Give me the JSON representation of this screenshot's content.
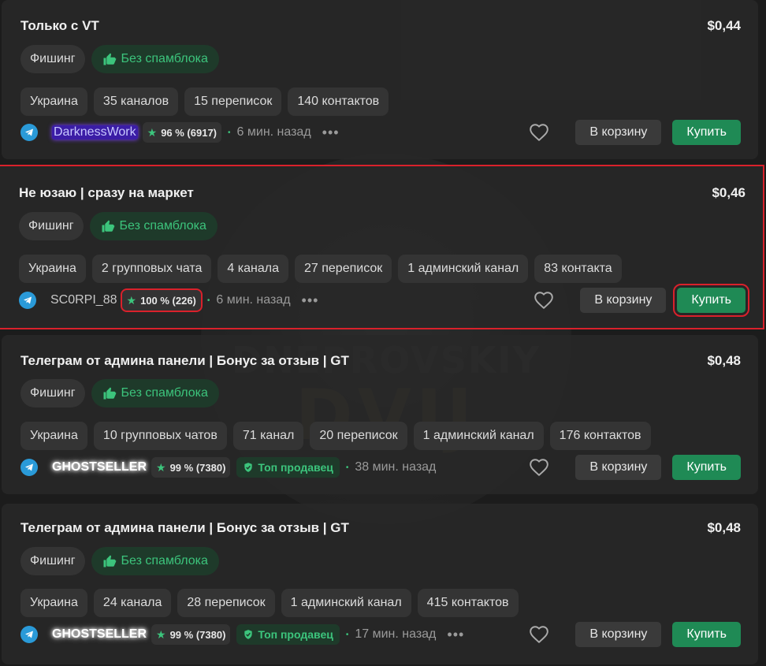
{
  "watermark": {
    "line1": "DNEPROVSKIY",
    "line2": "DVIJ"
  },
  "common": {
    "category": "Фишинг",
    "no_spamblock": "Без спамблока",
    "cart_label": "В корзину",
    "buy_label": "Купить",
    "more": "•••",
    "top_seller": "Топ продавец"
  },
  "listings": [
    {
      "title": "Только с VT",
      "price": "$0,44",
      "tags": [
        "Украина",
        "35 каналов",
        "15 переписок",
        "140 контактов"
      ],
      "seller": "DarknessWork",
      "rating": "96 % (6917)",
      "time": "6 мин. назад"
    },
    {
      "title": "Не юзаю | сразу на маркет",
      "price": "$0,46",
      "tags": [
        "Украина",
        "2 групповых чата",
        "4 канала",
        "27 переписок",
        "1 админский канал",
        "83 контакта"
      ],
      "seller": "SC0RPI_88",
      "rating": "100 % (226)",
      "time": "6 мин. назад"
    },
    {
      "title": "Телеграм от админа панели | Бонус за отзыв | GT",
      "price": "$0,48",
      "tags": [
        "Украина",
        "10 групповых чатов",
        "71 канал",
        "20 переписок",
        "1 админский канал",
        "176 контактов"
      ],
      "seller": "GHOSTSELLER",
      "rating": "99 % (7380)",
      "time": "38 мин. назад"
    },
    {
      "title": "Телеграм от админа панели | Бонус за отзыв | GT",
      "price": "$0,48",
      "tags": [
        "Украина",
        "24 канала",
        "28 переписок",
        "1 админский канал",
        "415 контактов"
      ],
      "seller": "GHOSTSELLER",
      "rating": "99 % (7380)",
      "time": "17 мин. назад"
    }
  ],
  "colors": {
    "accent": "#1f8a55",
    "highlight": "#d9212b",
    "background": "#1c1c1c"
  }
}
